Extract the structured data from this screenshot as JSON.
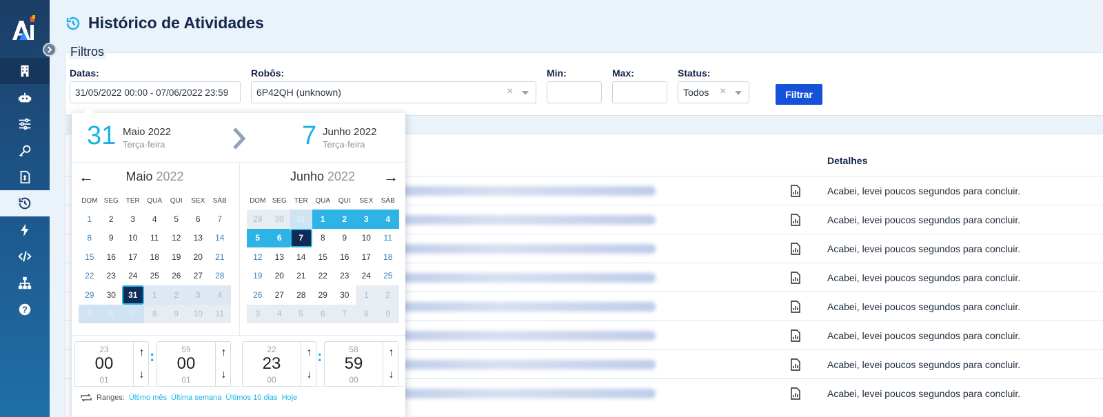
{
  "page": {
    "title": "Histórico de Atividades"
  },
  "sidebar": {
    "items": [
      "building-icon",
      "robot-icon",
      "sliders-icon",
      "key-icon",
      "invoice-icon",
      "history-icon",
      "bolt-icon",
      "code-icon",
      "network-icon",
      "help-icon"
    ],
    "active": "history-icon"
  },
  "filters": {
    "title": "Filtros",
    "dates_label": "Datas:",
    "dates_value": "31/05/2022 00:00 - 07/06/2022 23:59",
    "robots_label": "Robôs:",
    "robots_value": "6P42QH (unknown)",
    "min_label": "Min:",
    "max_label": "Max:",
    "status_label": "Status:",
    "status_value": "Todos",
    "filter_button": "Filtrar"
  },
  "table": {
    "detail_header": "Detalhes",
    "rows": [
      "Acabei, levei poucos segundos para concluir.",
      "Acabei, levei poucos segundos para concluir.",
      "Acabei, levei poucos segundos para concluir.",
      "Acabei, levei poucos segundos para concluir.",
      "Acabei, levei poucos segundos para concluir.",
      "Acabei, levei poucos segundos para concluir.",
      "Acabei, levei poucos segundos para concluir.",
      "Acabei, levei poucos segundos para concluir."
    ]
  },
  "datepicker": {
    "start": {
      "day": "31",
      "month": "Maio 2022",
      "weekday": "Terça-feira"
    },
    "end": {
      "day": "7",
      "month": "Junho 2022",
      "weekday": "Terça-feira"
    },
    "left_month": {
      "name": "Maio",
      "year": "2022"
    },
    "right_month": {
      "name": "Junho",
      "year": "2022"
    },
    "weekdays": [
      "DOM",
      "SEG",
      "TER",
      "QUA",
      "QUI",
      "SEX",
      "SÁB"
    ],
    "left_days": [
      [
        "1",
        "2",
        "3",
        "4",
        "5",
        "6",
        "7"
      ],
      [
        "8",
        "9",
        "10",
        "11",
        "12",
        "13",
        "14"
      ],
      [
        "15",
        "16",
        "17",
        "18",
        "19",
        "20",
        "21"
      ],
      [
        "22",
        "23",
        "24",
        "25",
        "26",
        "27",
        "28"
      ],
      [
        "29",
        "30",
        "31",
        "1",
        "2",
        "3",
        "4"
      ],
      [
        "5",
        "6",
        "7",
        "8",
        "9",
        "10",
        "11"
      ]
    ],
    "right_days": [
      [
        "29",
        "30",
        "31",
        "1",
        "2",
        "3",
        "4"
      ],
      [
        "5",
        "6",
        "7",
        "8",
        "9",
        "10",
        "11"
      ],
      [
        "12",
        "13",
        "14",
        "15",
        "16",
        "17",
        "18"
      ],
      [
        "19",
        "20",
        "21",
        "22",
        "23",
        "24",
        "25"
      ],
      [
        "26",
        "27",
        "28",
        "29",
        "30",
        "1",
        "2"
      ],
      [
        "3",
        "4",
        "5",
        "6",
        "7",
        "8",
        "9"
      ]
    ],
    "time": {
      "start_hour": {
        "prev": "23",
        "cur": "00",
        "next": "01"
      },
      "start_min": {
        "prev": "59",
        "cur": "00",
        "next": "01"
      },
      "end_hour": {
        "prev": "22",
        "cur": "23",
        "next": "00"
      },
      "end_min": {
        "prev": "58",
        "cur": "59",
        "next": "00"
      }
    },
    "ranges_label": "Ranges:",
    "ranges": [
      "Último mês",
      "Última semana",
      "Últimos 10 dias",
      "Hoje"
    ]
  },
  "colors": {
    "accent": "#1ab0e8",
    "primary_button": "#1652d8",
    "sidebar": "#1b3d66"
  }
}
